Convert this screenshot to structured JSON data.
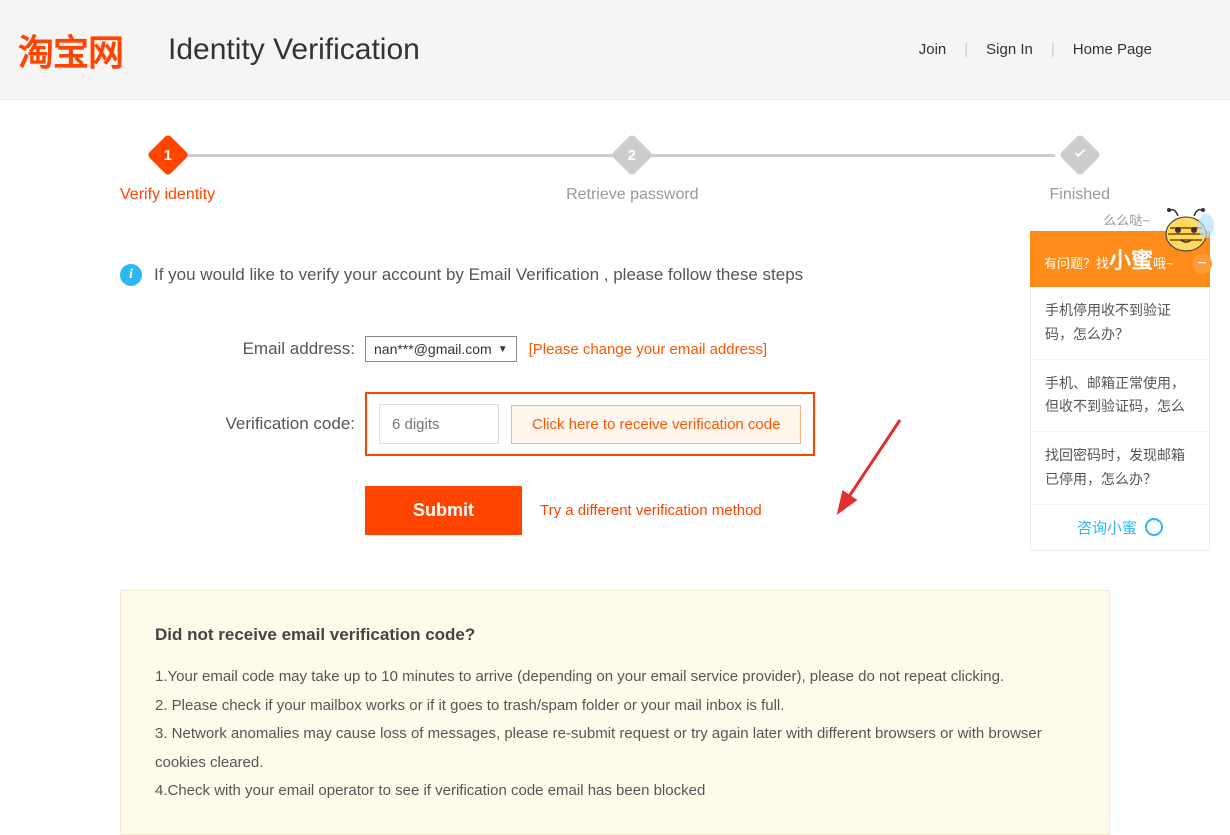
{
  "header": {
    "logo": "淘宝网",
    "title": "Identity Verification",
    "nav": {
      "join": "Join",
      "signin": "Sign In",
      "home": "Home Page"
    }
  },
  "steps": {
    "s1": {
      "num": "1",
      "label": "Verify identity"
    },
    "s2": {
      "num": "2",
      "label": "Retrieve password"
    },
    "s3": {
      "check": "✓",
      "label": "Finished"
    }
  },
  "info": {
    "text": "If you would like to verify your account by Email Verification , please follow these steps"
  },
  "form": {
    "email_label": "Email address:",
    "email_value": "nan***@gmail.com",
    "change_hint": "[Please change your email address]",
    "code_label": "Verification code:",
    "code_placeholder": "6 digits",
    "receive_btn": "Click here to receive verification code",
    "submit": "Submit",
    "alt_method": "Try a different verification method"
  },
  "help": {
    "title": "Did not receive email verification code?",
    "line1": "1.Your email code may take up to 10 minutes to arrive (depending on your email service provider), please do not repeat clicking.",
    "line2": "2. Please check if your mailbox works or if it goes to trash/spam folder or your mail inbox is full.",
    "line3": "3. Network anomalies may cause loss of messages, please re-submit request or try again later with different browsers or with browser cookies cleared.",
    "line4": "4.Check with your email operator to see if verification code email has been blocked"
  },
  "sidebar": {
    "bubble": "么么哒~",
    "header_pre": "有问题？找",
    "header_big": "小蜜",
    "header_suf": "哦~",
    "items": {
      "i1": "手机停用收不到验证码，怎么办？",
      "i2": "手机、邮箱正常使用，但收不到验证码，怎么",
      "i3": "找回密码时，发现邮箱已停用，怎么办？"
    },
    "footer": "咨询小蜜"
  }
}
